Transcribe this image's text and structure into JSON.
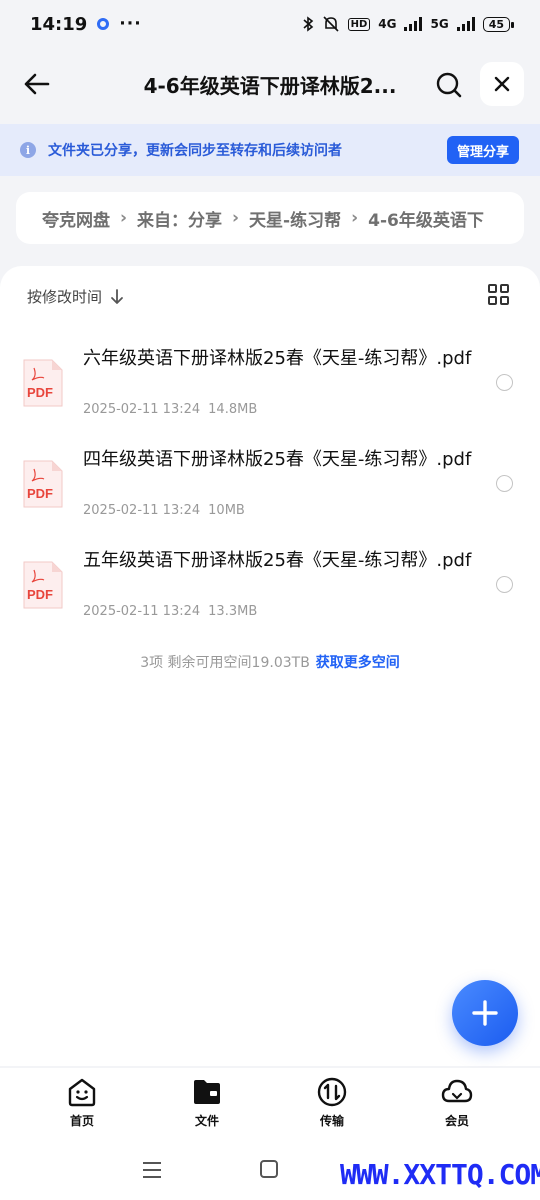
{
  "status_bar": {
    "time": "14:19",
    "more": "···",
    "net1": "HD",
    "net2": "4G",
    "net3": "5G",
    "battery": "45"
  },
  "header": {
    "title": "4-6年级英语下册译林版2..."
  },
  "share_notice": {
    "text": "文件夹已分享，更新会同步至转存和后续访问者",
    "manage_label": "管理分享"
  },
  "breadcrumb": [
    "夸克网盘",
    "来自：分享",
    "天星-练习帮",
    "4-6年级英语下"
  ],
  "sort": {
    "label": "按修改时间"
  },
  "files": [
    {
      "name": "六年级英语下册译林版25春《天星-练习帮》.pdf",
      "date": "2025-02-11 13:24",
      "size": "14.8MB",
      "type_label": "PDF"
    },
    {
      "name": "四年级英语下册译林版25春《天星-练习帮》.pdf",
      "date": "2025-02-11 13:24",
      "size": "10MB",
      "type_label": "PDF"
    },
    {
      "name": "五年级英语下册译林版25春《天星-练习帮》.pdf",
      "date": "2025-02-11 13:24",
      "size": "13.3MB",
      "type_label": "PDF"
    }
  ],
  "summary": {
    "text": "3项 剩余可用空间19.03TB",
    "link": "获取更多空间"
  },
  "bottom_nav": [
    {
      "label": "首页",
      "icon": "smiley-home-icon"
    },
    {
      "label": "文件",
      "icon": "folder-icon"
    },
    {
      "label": "传输",
      "icon": "transfer-icon"
    },
    {
      "label": "会员",
      "icon": "cloud-member-icon"
    }
  ],
  "watermark": "WWW.XXTTQ.COM",
  "colors": {
    "accent": "#2162f5",
    "notice_bg": "#e5ebfb",
    "pdf_red": "#e8453c"
  }
}
